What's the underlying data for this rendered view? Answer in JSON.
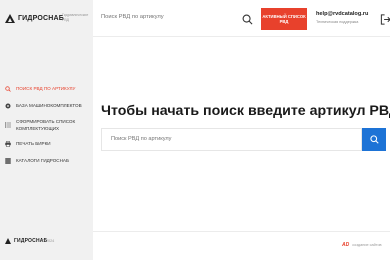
{
  "brand": {
    "name": "ГИДРОСНАБ",
    "subtitle": "Гидравлические РВД"
  },
  "sidebar": {
    "items": [
      {
        "label": "ПОИСК РВД ПО АРТИКУЛУ",
        "icon": "search-icon",
        "active": true
      },
      {
        "label": "БАЗА МАШИНОКОМПЛЕКТОВ",
        "icon": "gear-icon",
        "active": false
      },
      {
        "label": "СФОРМИРОВАТЬ СПИСОК КОМПЛЕКТУЮЩИХ",
        "icon": "list-icon",
        "active": false
      },
      {
        "label": "ПЕЧАТЬ БИРКИ",
        "icon": "print-icon",
        "active": false
      },
      {
        "label": "КАТАЛОГИ ГИДРОСНАБ",
        "icon": "catalog-icon",
        "active": false
      }
    ],
    "footer_brand": "ГИДРОСНАБ",
    "footer_year": "© 2024"
  },
  "topbar": {
    "search_placeholder": "Поиск РВД по артикулу",
    "active_list_label": "АКТИВНЫЙ СПИСОК РВД",
    "email": "help@rvdcatalog.ru",
    "support_label": "Техническая поддержка"
  },
  "main": {
    "heading": "Чтобы начать поиск введите артикул РВД",
    "search_placeholder": "Поиск РВД по артикулу"
  },
  "footer": {
    "credit_mark": "AD",
    "credit_text": "создание сайтов"
  },
  "colors": {
    "accent": "#e8412c",
    "primary_button": "#1d73d6",
    "sidebar_bg": "#f1f1f1"
  }
}
